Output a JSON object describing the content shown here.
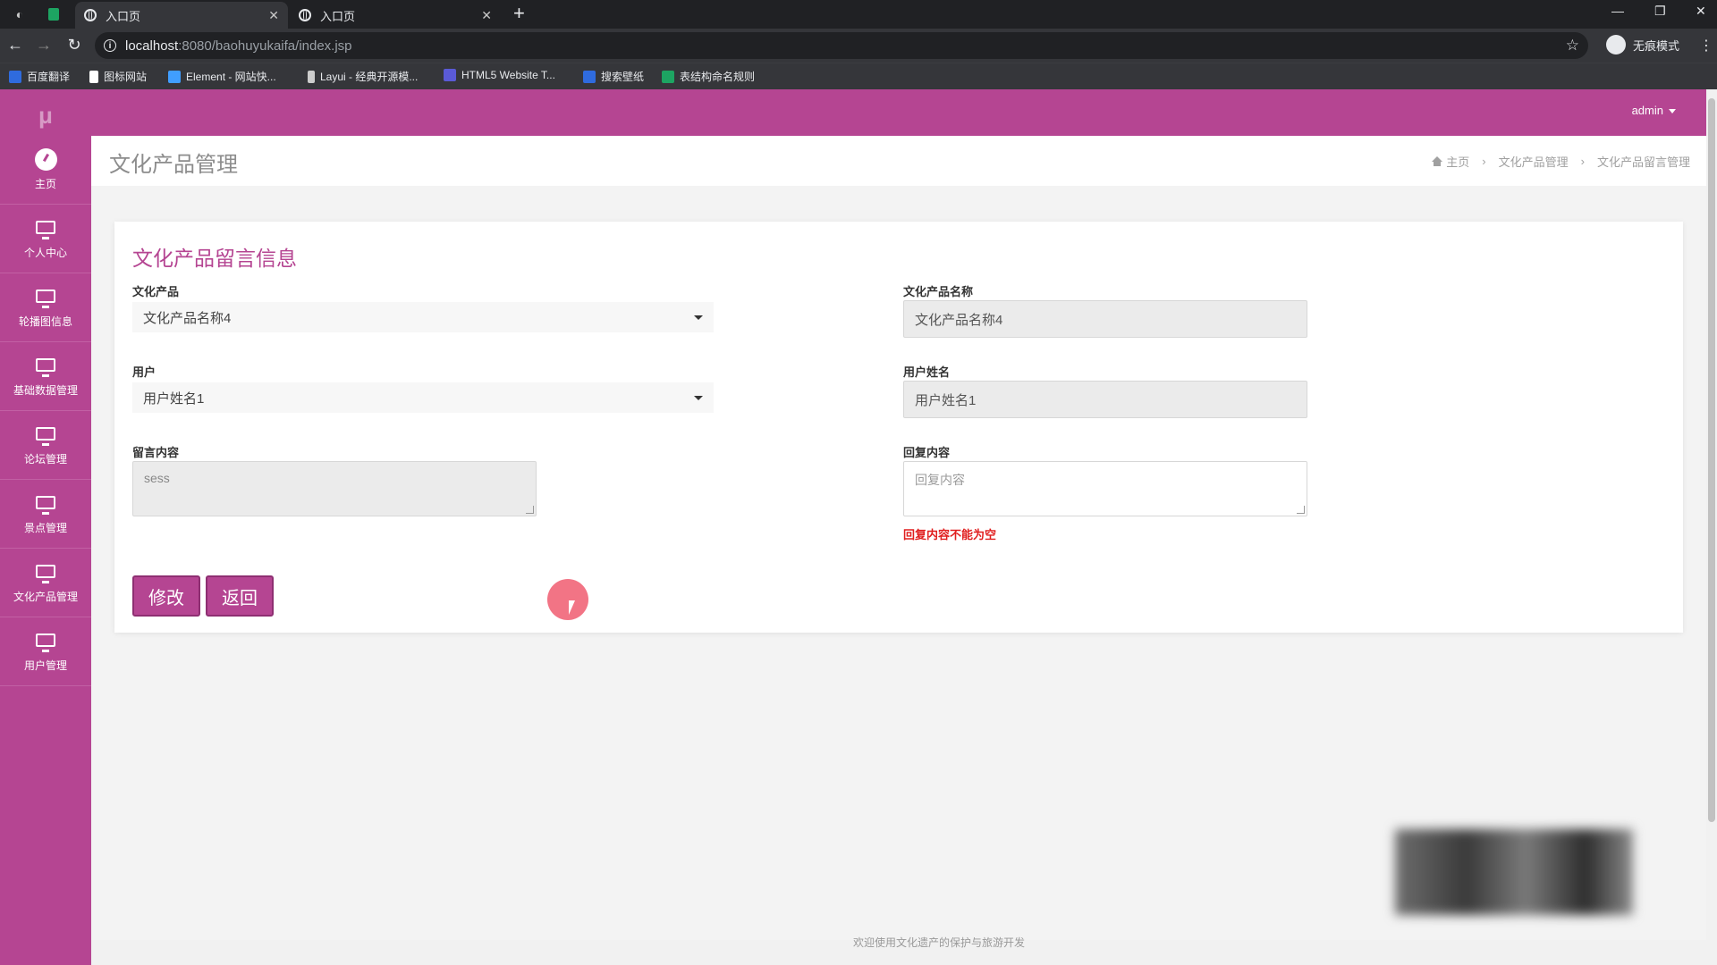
{
  "browser": {
    "tabs": [
      {
        "title": "入口页",
        "active": true
      },
      {
        "title": "入口页",
        "active": false
      }
    ],
    "new_tab_symbol": "+",
    "url_host": "localhost",
    "url_rest": ":8080/baohuyukaifa/index.jsp",
    "incognito_label": "无痕模式",
    "bookmarks": [
      {
        "label": "百度翻译",
        "color": "#2f6bde"
      },
      {
        "label": "图标网站",
        "color": "#ffffff"
      },
      {
        "label": "Element - 网站快...",
        "color": "#409eff"
      },
      {
        "label": "Layui - 经典开源模...",
        "color": "#cccccc"
      },
      {
        "label": "HTML5 Website T...",
        "color": "#5a5ad6"
      },
      {
        "label": "搜索壁纸",
        "color": "#2f6bde"
      },
      {
        "label": "表结构命名规则",
        "color": "#1da462"
      }
    ]
  },
  "sidebar": {
    "logo": "μ",
    "items": [
      {
        "label": "主页",
        "icon": "dashboard-icon"
      },
      {
        "label": "个人中心",
        "icon": "monitor-icon"
      },
      {
        "label": "轮播图信息",
        "icon": "monitor-icon"
      },
      {
        "label": "基础数据管理",
        "icon": "monitor-icon"
      },
      {
        "label": "论坛管理",
        "icon": "monitor-icon"
      },
      {
        "label": "景点管理",
        "icon": "monitor-icon"
      },
      {
        "label": "文化产品管理",
        "icon": "monitor-icon"
      },
      {
        "label": "用户管理",
        "icon": "monitor-icon"
      }
    ]
  },
  "header": {
    "user": "admin"
  },
  "page": {
    "title": "文化产品管理",
    "breadcrumb": [
      "主页",
      "文化产品管理",
      "文化产品留言管理"
    ],
    "sep": "›"
  },
  "form": {
    "title": "文化产品留言信息",
    "product_label": "文化产品",
    "product_value": "文化产品名称4",
    "product_name_label": "文化产品名称",
    "product_name_value": "文化产品名称4",
    "user_label": "用户",
    "user_value": "用户姓名1",
    "user_name_label": "用户姓名",
    "user_name_value": "用户姓名1",
    "message_label": "留言内容",
    "message_value": "sess",
    "reply_label": "回复内容",
    "reply_placeholder": "回复内容",
    "reply_error": "回复内容不能为空",
    "submit_label": "修改",
    "back_label": "返回"
  },
  "footer": {
    "text": "欢迎使用文化遗产的保护与旅游开发"
  },
  "colors": {
    "brand": "#b54592",
    "error": "#e01e1e"
  }
}
